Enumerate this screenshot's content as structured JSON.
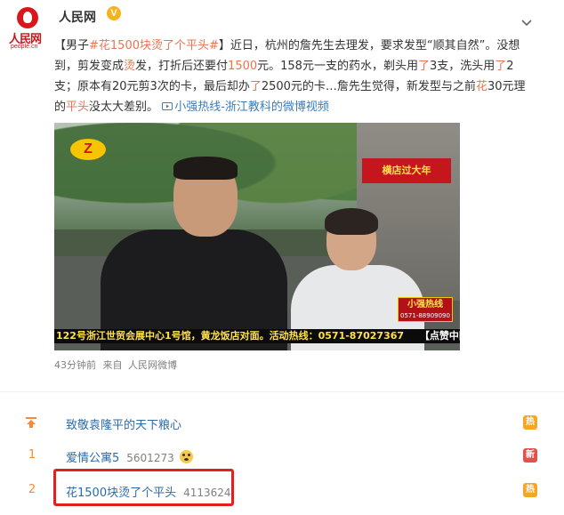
{
  "account": {
    "name": "人民网",
    "verified_mark": "V",
    "avatar_brand": "人民网",
    "avatar_url": "people.cn"
  },
  "post": {
    "text_open": "【男子",
    "topic": "#花1500块烫了个平头#",
    "text_1": "】近日，杭州的詹先生去理发，要求发型“顺其自然”。没想到，剪发变成",
    "hl_1": "烫",
    "text_2": "发，打折后还要付",
    "hl_2": "1500",
    "text_3": "元。158元一支的药水，剃头用",
    "hl_3": "了",
    "text_4": "3支，洗头用",
    "hl_4": "了",
    "text_5": "2支；原本有20元剪3次的卡，最后却办",
    "hl_5": "了",
    "text_6": "2500元的卡…詹先生觉得，新发型与之前",
    "hl_6": "花",
    "text_7": "30元理的",
    "hl_7": "平头",
    "text_8": "没太大差别。",
    "video_link": "小强热线-浙江教科的微博视频"
  },
  "video": {
    "channel_logo": "Z",
    "shop_sign": "横店过大年",
    "ticker": "122号浙江世贸会展中心1号馆，黄龙饭店对面。活动热线：0571-87027367",
    "ticker_right": "【点赞中国分",
    "show_logo": "小强热线",
    "show_phone": "0571-88909090"
  },
  "meta": {
    "time": "43分钟前",
    "source_prefix": "来自",
    "source": "人民网微博"
  },
  "hot_search": {
    "rows": [
      {
        "rank": "",
        "title": "致敬袁隆平的天下粮心",
        "count": "",
        "badge": "热"
      },
      {
        "rank": "1",
        "title": "爱情公寓5",
        "count": "5601273",
        "badge": "新"
      },
      {
        "rank": "2",
        "title": "花1500块烫了个平头",
        "count": "4113624",
        "badge": "热"
      }
    ]
  },
  "colors": {
    "topic": "#eb7350",
    "link": "#2b6aa8",
    "highlight_box": "#e0221f",
    "badge_hot": "#f5a623",
    "badge_new": "#e2524d"
  }
}
